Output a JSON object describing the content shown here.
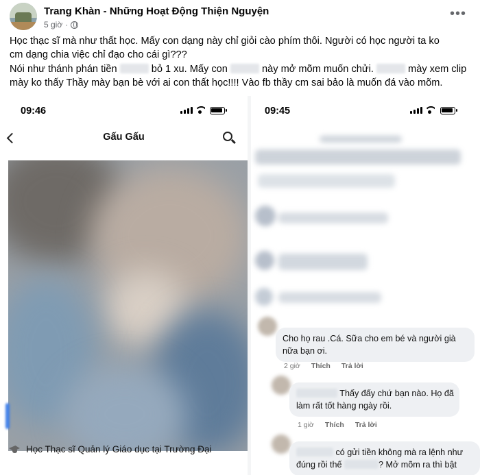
{
  "post": {
    "author": "Trang Khàn - Những Hoạt Động Thiện Nguyện",
    "time": "5 giờ",
    "lines": [
      {
        "a": "Học thạc sĩ mà như thất học. Mấy con dạng này chỉ giỏi cào phím thôi. Người có học người ta ko"
      },
      {
        "a": "cm dạng chia việc chỉ đạo cho cái gì???"
      },
      {
        "a": "Nói như thánh phán tiền",
        "b": "bỏ 1 xu. Mấy con",
        "c": "này mở mõm muốn chửi.",
        "d": "mày xem clip"
      },
      {
        "a": "mày ko thấy Thầy mày bạn bè với ai con thất học!!!! Vào fb thầy cm sai bảo là muốn đá vào mõm."
      }
    ]
  },
  "left_phone": {
    "time": "09:46",
    "title": "Gấu Gấu",
    "bio": "Học Thạc sĩ Quản lý Giáo dục tại Trường Đại"
  },
  "right_phone": {
    "time": "09:45",
    "comment1": {
      "line1": "Cho họ rau .Cá. Sữa cho em bé và người già",
      "line2": "nữa bạn ơi.",
      "time": "2 giờ",
      "like": "Thích",
      "reply": "Trả lời"
    },
    "comment2": {
      "line1": "Thấy đấy chứ bạn nào. Họ đã",
      "line2": "làm rất tốt hàng ngày rồi.",
      "time": "1 giờ",
      "like": "Thích",
      "reply": "Trả lời"
    },
    "comment3": {
      "line1": "có gửi tiền không mà ra lệnh như",
      "line2a": "đúng rồi thế",
      "line2b": "? Mở mõm ra thì bật"
    }
  },
  "colors": {
    "accent_blue": "#3f7fe8",
    "bubble_bg": "#eef0f3",
    "meta_text": "#65676b"
  },
  "icons": [
    "globe-icon",
    "more-icon",
    "back-icon",
    "search-icon",
    "wifi-icon",
    "battery-icon",
    "graduation-cap-icon"
  ]
}
